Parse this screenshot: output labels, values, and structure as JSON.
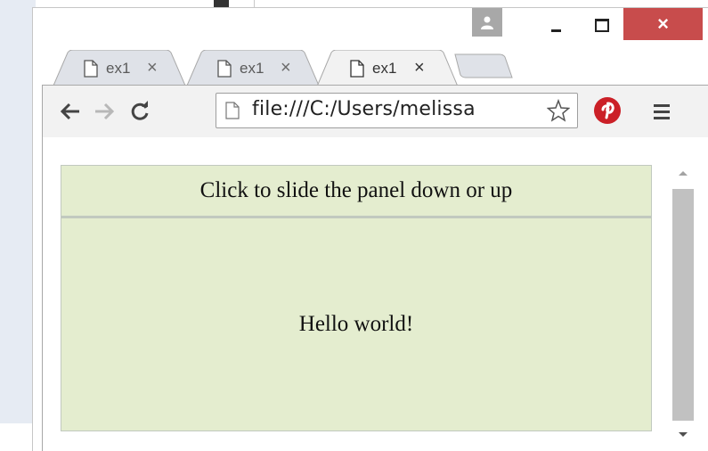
{
  "window": {
    "tabs": [
      {
        "label": "ex1",
        "close": "×"
      },
      {
        "label": "ex1",
        "close": "×"
      },
      {
        "label": "ex1",
        "close": "×"
      }
    ],
    "close_glyph": "×"
  },
  "toolbar": {
    "url": "file:///C:/Users/melissa"
  },
  "page": {
    "flip_text": "Click to slide the panel down or up",
    "panel_text": "Hello world!"
  },
  "colors": {
    "panel_bg": "#e4edcf",
    "close_button": "#c84c4c",
    "pinterest": "#cb2027"
  }
}
